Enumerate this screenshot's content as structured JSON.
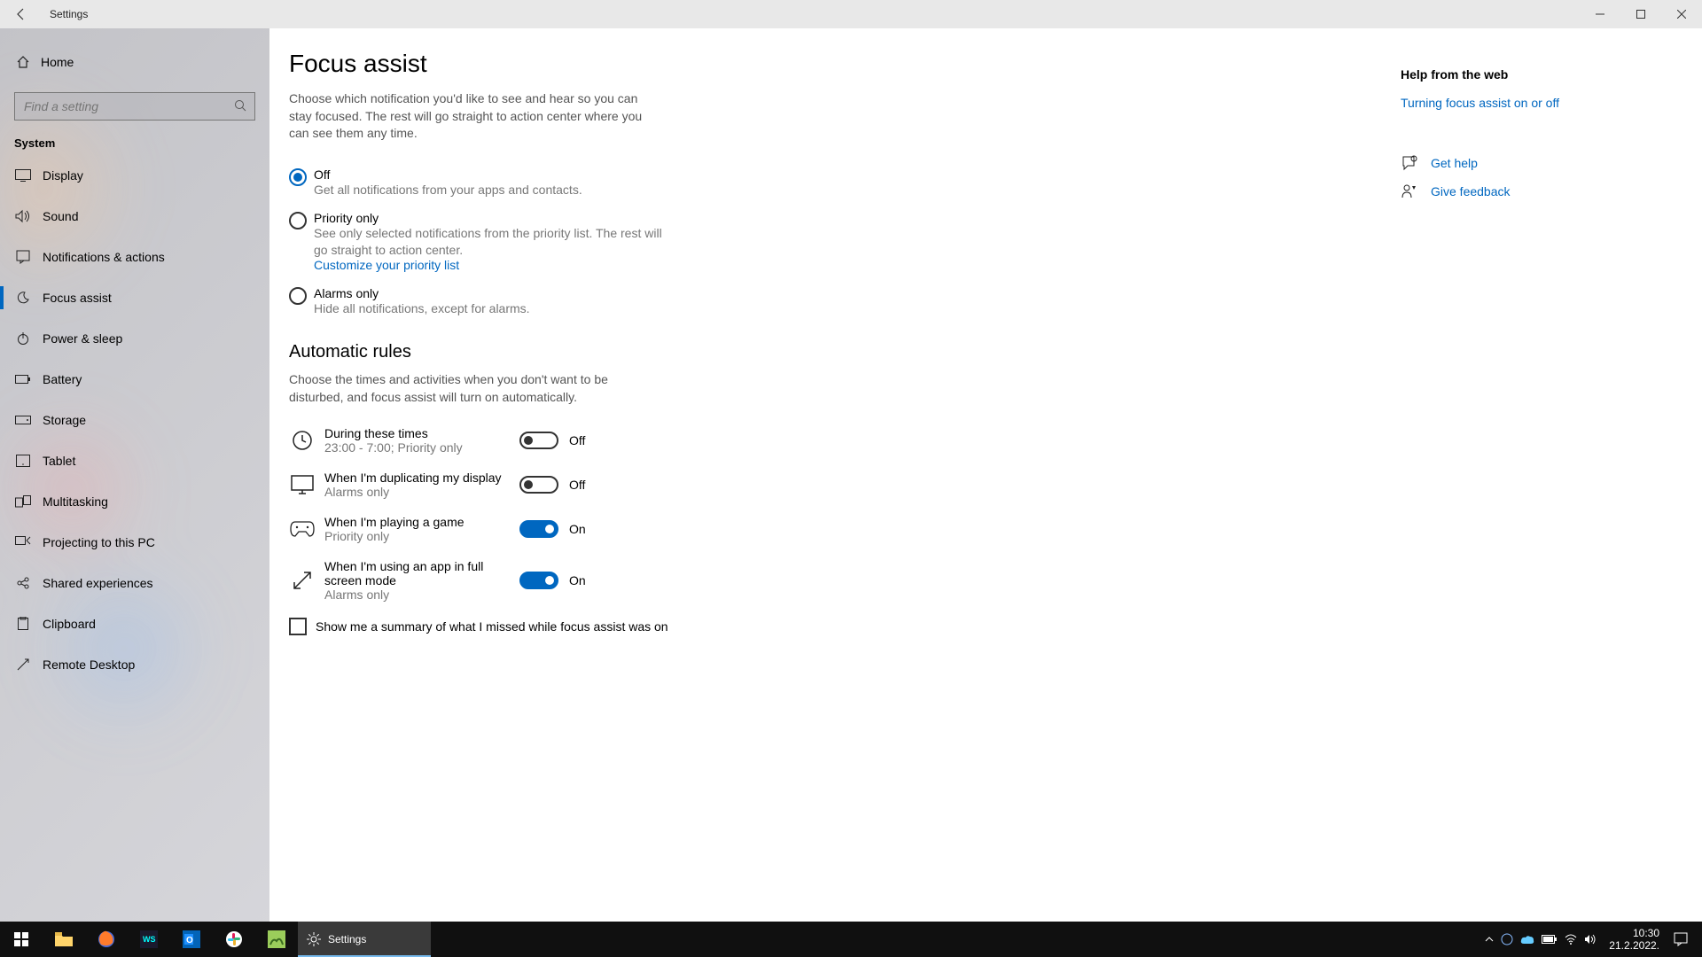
{
  "titlebar": {
    "title": "Settings"
  },
  "sidebar": {
    "home": "Home",
    "search_placeholder": "Find a setting",
    "group": "System",
    "items": [
      {
        "label": "Display"
      },
      {
        "label": "Sound"
      },
      {
        "label": "Notifications & actions"
      },
      {
        "label": "Focus assist"
      },
      {
        "label": "Power & sleep"
      },
      {
        "label": "Battery"
      },
      {
        "label": "Storage"
      },
      {
        "label": "Tablet"
      },
      {
        "label": "Multitasking"
      },
      {
        "label": "Projecting to this PC"
      },
      {
        "label": "Shared experiences"
      },
      {
        "label": "Clipboard"
      },
      {
        "label": "Remote Desktop"
      }
    ],
    "selected_index": 3
  },
  "page": {
    "title": "Focus assist",
    "description": "Choose which notification you'd like to see and hear so you can stay focused. The rest will go straight to action center where you can see them any time.",
    "radios": {
      "off": {
        "label": "Off",
        "desc": "Get all notifications from your apps and contacts."
      },
      "priority": {
        "label": "Priority only",
        "desc": "See only selected notifications from the priority list. The rest will go straight to action center.",
        "link": "Customize your priority list"
      },
      "alarms": {
        "label": "Alarms only",
        "desc": "Hide all notifications, except for alarms."
      },
      "selected": "off"
    },
    "auto_section_title": "Automatic rules",
    "auto_section_desc": "Choose the times and activities when you don't want to be disturbed, and focus assist will turn on automatically.",
    "rules": [
      {
        "title": "During these times",
        "sub": "23:00 - 7:00; Priority only",
        "on": false
      },
      {
        "title": "When I'm duplicating my display",
        "sub": "Alarms only",
        "on": false
      },
      {
        "title": "When I'm playing a game",
        "sub": "Priority only",
        "on": true
      },
      {
        "title": "When I'm using an app in full screen mode",
        "sub": "Alarms only",
        "on": true
      }
    ],
    "toggle_on_label": "On",
    "toggle_off_label": "Off",
    "summary_checkbox": "Show me a summary of what I missed while focus assist was on"
  },
  "aside": {
    "help_heading": "Help from the web",
    "help_link": "Turning focus assist on or off",
    "get_help": "Get help",
    "give_feedback": "Give feedback"
  },
  "taskbar": {
    "active_label": "Settings",
    "time": "10:30",
    "date": "21.2.2022."
  }
}
